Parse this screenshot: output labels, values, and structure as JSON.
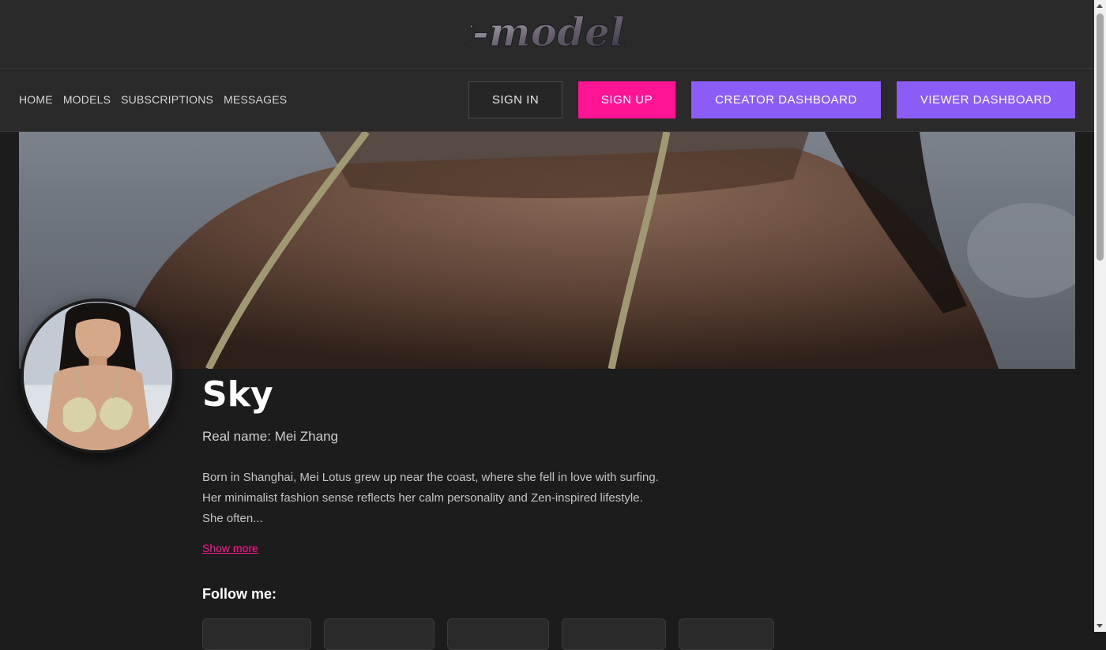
{
  "header": {
    "logo_text": "x-models"
  },
  "nav": {
    "links": [
      "HOME",
      "MODELS",
      "SUBSCRIPTIONS",
      "MESSAGES"
    ],
    "sign_in": "SIGN IN",
    "sign_up": "SIGN UP",
    "creator_dashboard": "CREATOR DASHBOARD",
    "viewer_dashboard": "VIEWER DASHBOARD"
  },
  "profile": {
    "name": "Sky",
    "real_name": "Real name: Mei Zhang",
    "bio_lines": [
      "Born in Shanghai, Mei Lotus grew up near the coast, where she fell in love with surfing.",
      "Her minimalist fashion sense reflects her calm personality and Zen-inspired lifestyle.",
      "She often..."
    ],
    "show_more": "Show more",
    "follow_title": "Follow me:"
  },
  "colors": {
    "accent_pink": "#ff1493",
    "accent_purple": "#8b5cf6",
    "background": "#1c1c1c",
    "bar": "#2a2a2a"
  }
}
